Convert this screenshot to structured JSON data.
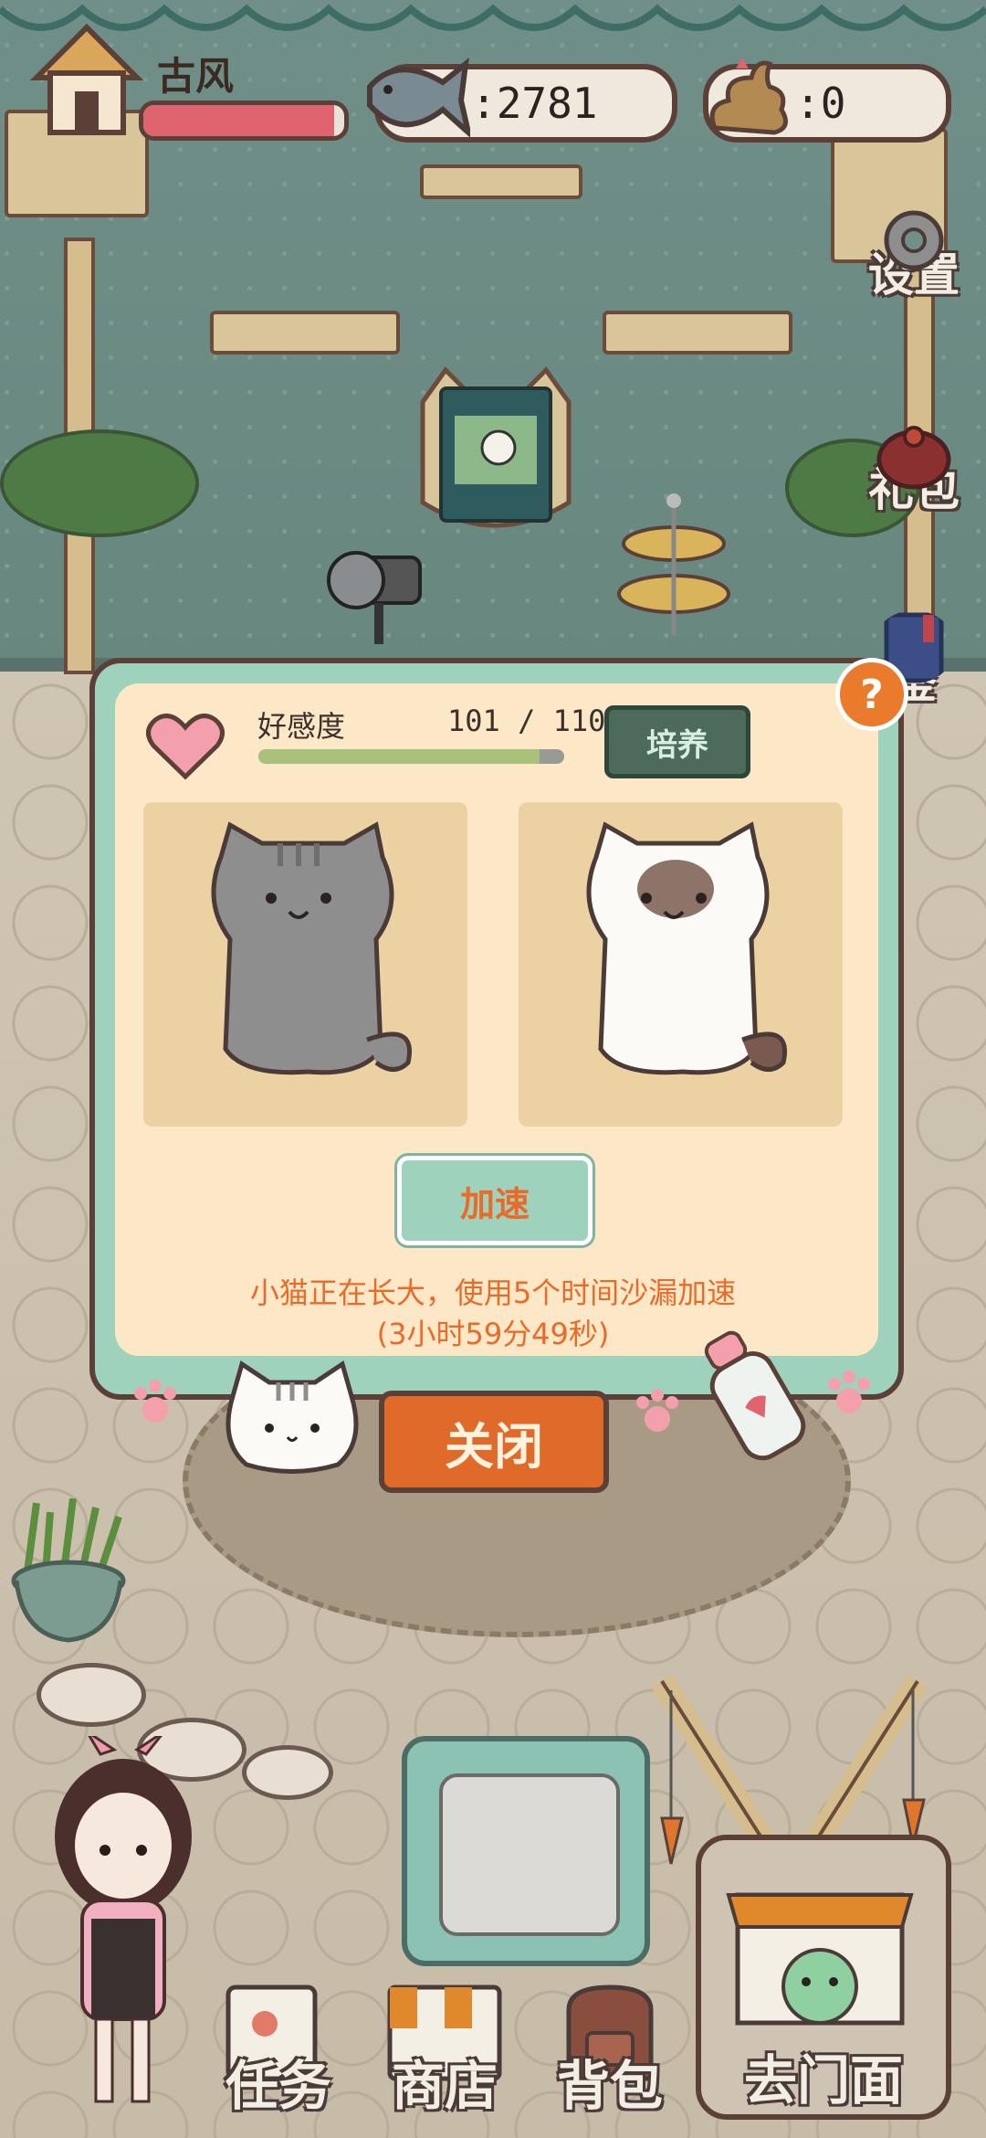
{
  "player": {
    "name": "古风",
    "hp_fraction": 0.95
  },
  "currency": {
    "fish": "2781",
    "fish_prefix": ":",
    "poop": "0",
    "poop_prefix": ":"
  },
  "side_menu": [
    {
      "label": "设置",
      "icon": "gear-icon"
    },
    {
      "label": "礼包",
      "icon": "gift-bag-icon"
    },
    {
      "label": "鉴",
      "icon": "book-icon"
    }
  ],
  "dialog": {
    "help": "?",
    "favor_label": "好感度",
    "favor_count": "101 / 110",
    "favor_fraction": 0.918,
    "nurture_button": "培养",
    "speed_button": "加速",
    "hint_line1": "小猫正在长大，使用5个时间沙漏加速",
    "hint_line2": "(3小时59分49秒)"
  },
  "close_button": "关闭",
  "bottom_nav": [
    {
      "label": "任务"
    },
    {
      "label": "商店"
    },
    {
      "label": "背包"
    },
    {
      "label": "去门面"
    }
  ],
  "colors": {
    "wall": "#6f8f88",
    "dialog_frame": "#9fd2bc",
    "dialog_panel": "#fce8c6",
    "accent_orange": "#ea6a2a",
    "hp_red": "#e06470",
    "favor_green": "#a9c17a"
  }
}
